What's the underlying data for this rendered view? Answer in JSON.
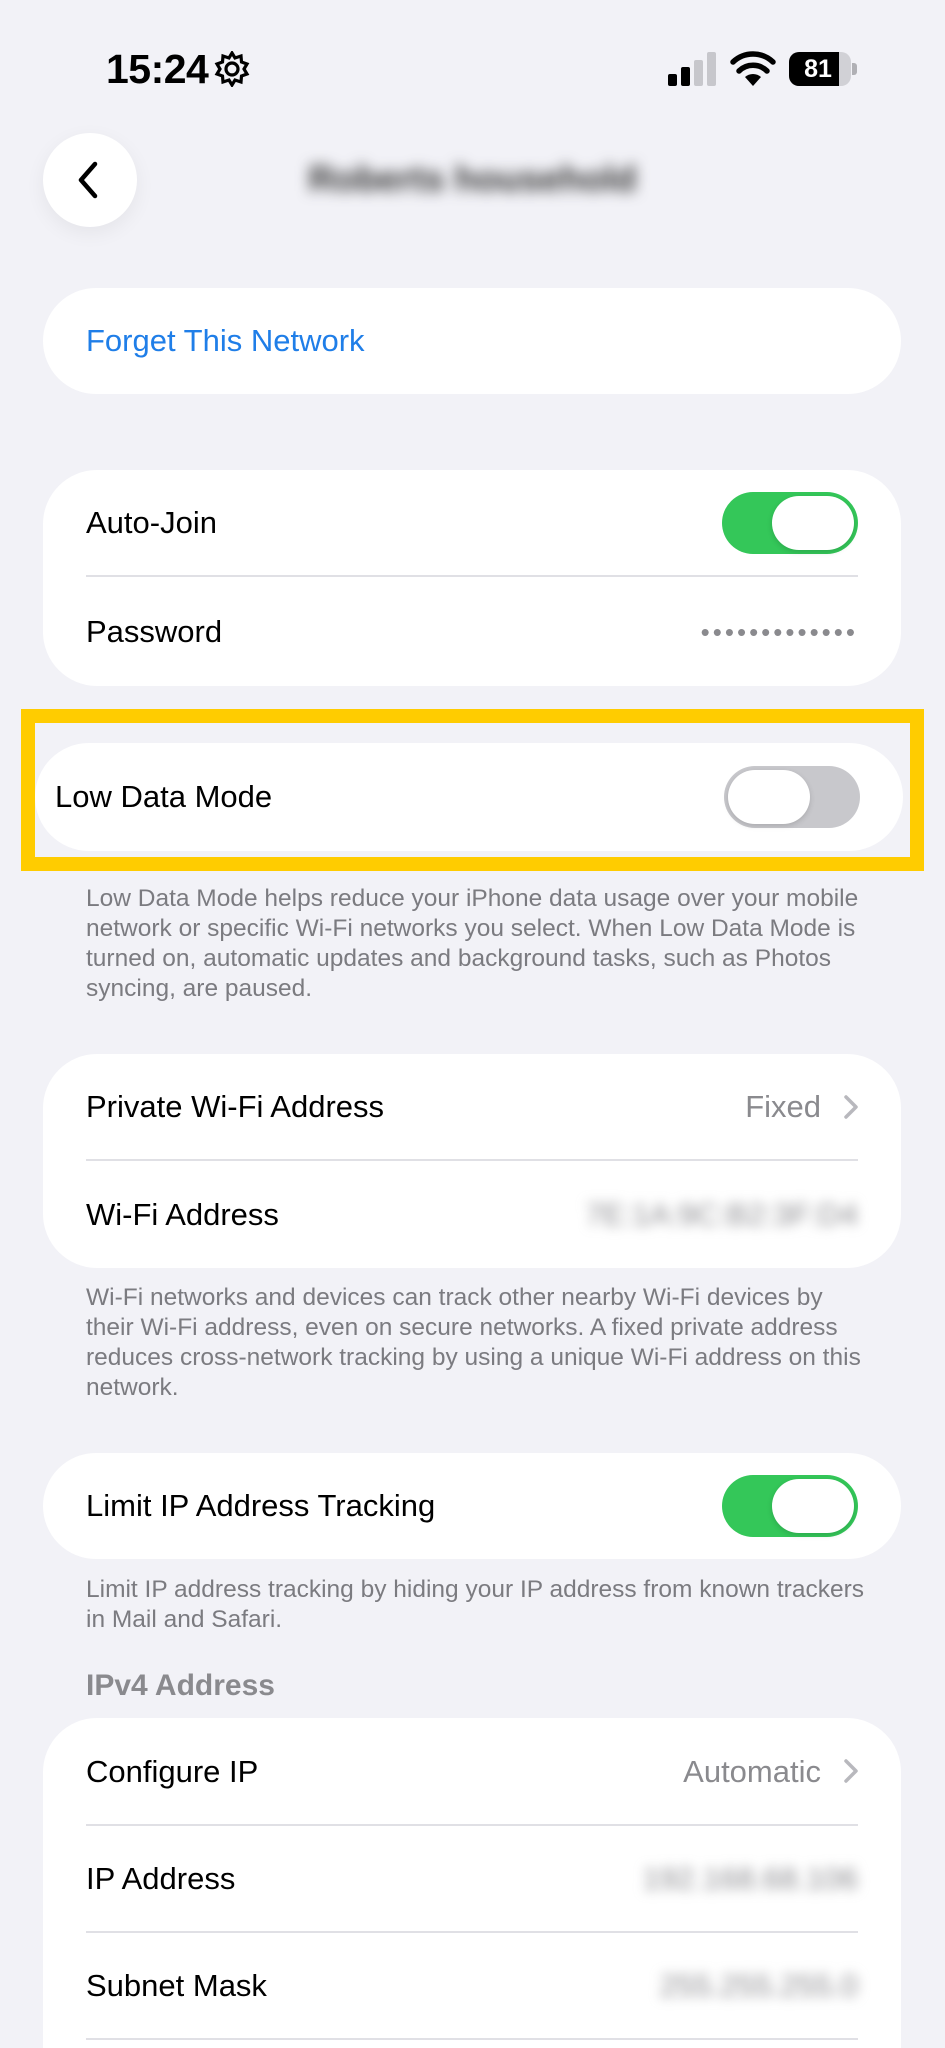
{
  "status_bar": {
    "time": "15:24",
    "battery_level": "81",
    "battery_fraction": 0.81
  },
  "nav": {
    "title": "Roberts household"
  },
  "forget": {
    "label": "Forget This Network"
  },
  "join_card": {
    "auto_join_label": "Auto-Join",
    "auto_join_on": true,
    "password_label": "Password",
    "password_value": "•••••••••••••"
  },
  "low_data": {
    "label": "Low Data Mode",
    "on": false,
    "footnote": "Low Data Mode helps reduce your iPhone data usage over your mobile network or specific Wi-Fi networks you select. When Low Data Mode is turned on, automatic updates and background tasks, such as Photos syncing, are paused."
  },
  "private_card": {
    "private_label": "Private Wi-Fi Address",
    "private_value": "Fixed",
    "wifi_address_label": "Wi-Fi Address",
    "wifi_address_value": "7E:1A:9C:B2:3F:D4",
    "footnote": "Wi-Fi networks and devices can track other nearby Wi-Fi devices by their Wi-Fi address, even on secure networks. A fixed private address reduces cross-network tracking by using a unique Wi-Fi address on this network."
  },
  "limit_ip": {
    "label": "Limit IP Address Tracking",
    "on": true,
    "footnote": "Limit IP address tracking by hiding your IP address from known trackers in Mail and Safari."
  },
  "ipv4": {
    "header": "IPv4 Address",
    "configure_label": "Configure IP",
    "configure_value": "Automatic",
    "ip_label": "IP Address",
    "ip_value": "192.168.68.106",
    "subnet_label": "Subnet Mask",
    "subnet_value": "255.255.255.0"
  },
  "colors": {
    "accent_blue": "#1f7ee8",
    "toggle_green": "#34c759",
    "highlight_yellow": "#ffcc00",
    "background": "#f2f2f7"
  },
  "icons": {
    "back": "chevron-left-icon",
    "row_disclosure": "chevron-right-icon",
    "status_gear": "gear-icon",
    "signal": "cellular-signal-icon",
    "wifi": "wifi-icon",
    "battery": "battery-icon"
  }
}
